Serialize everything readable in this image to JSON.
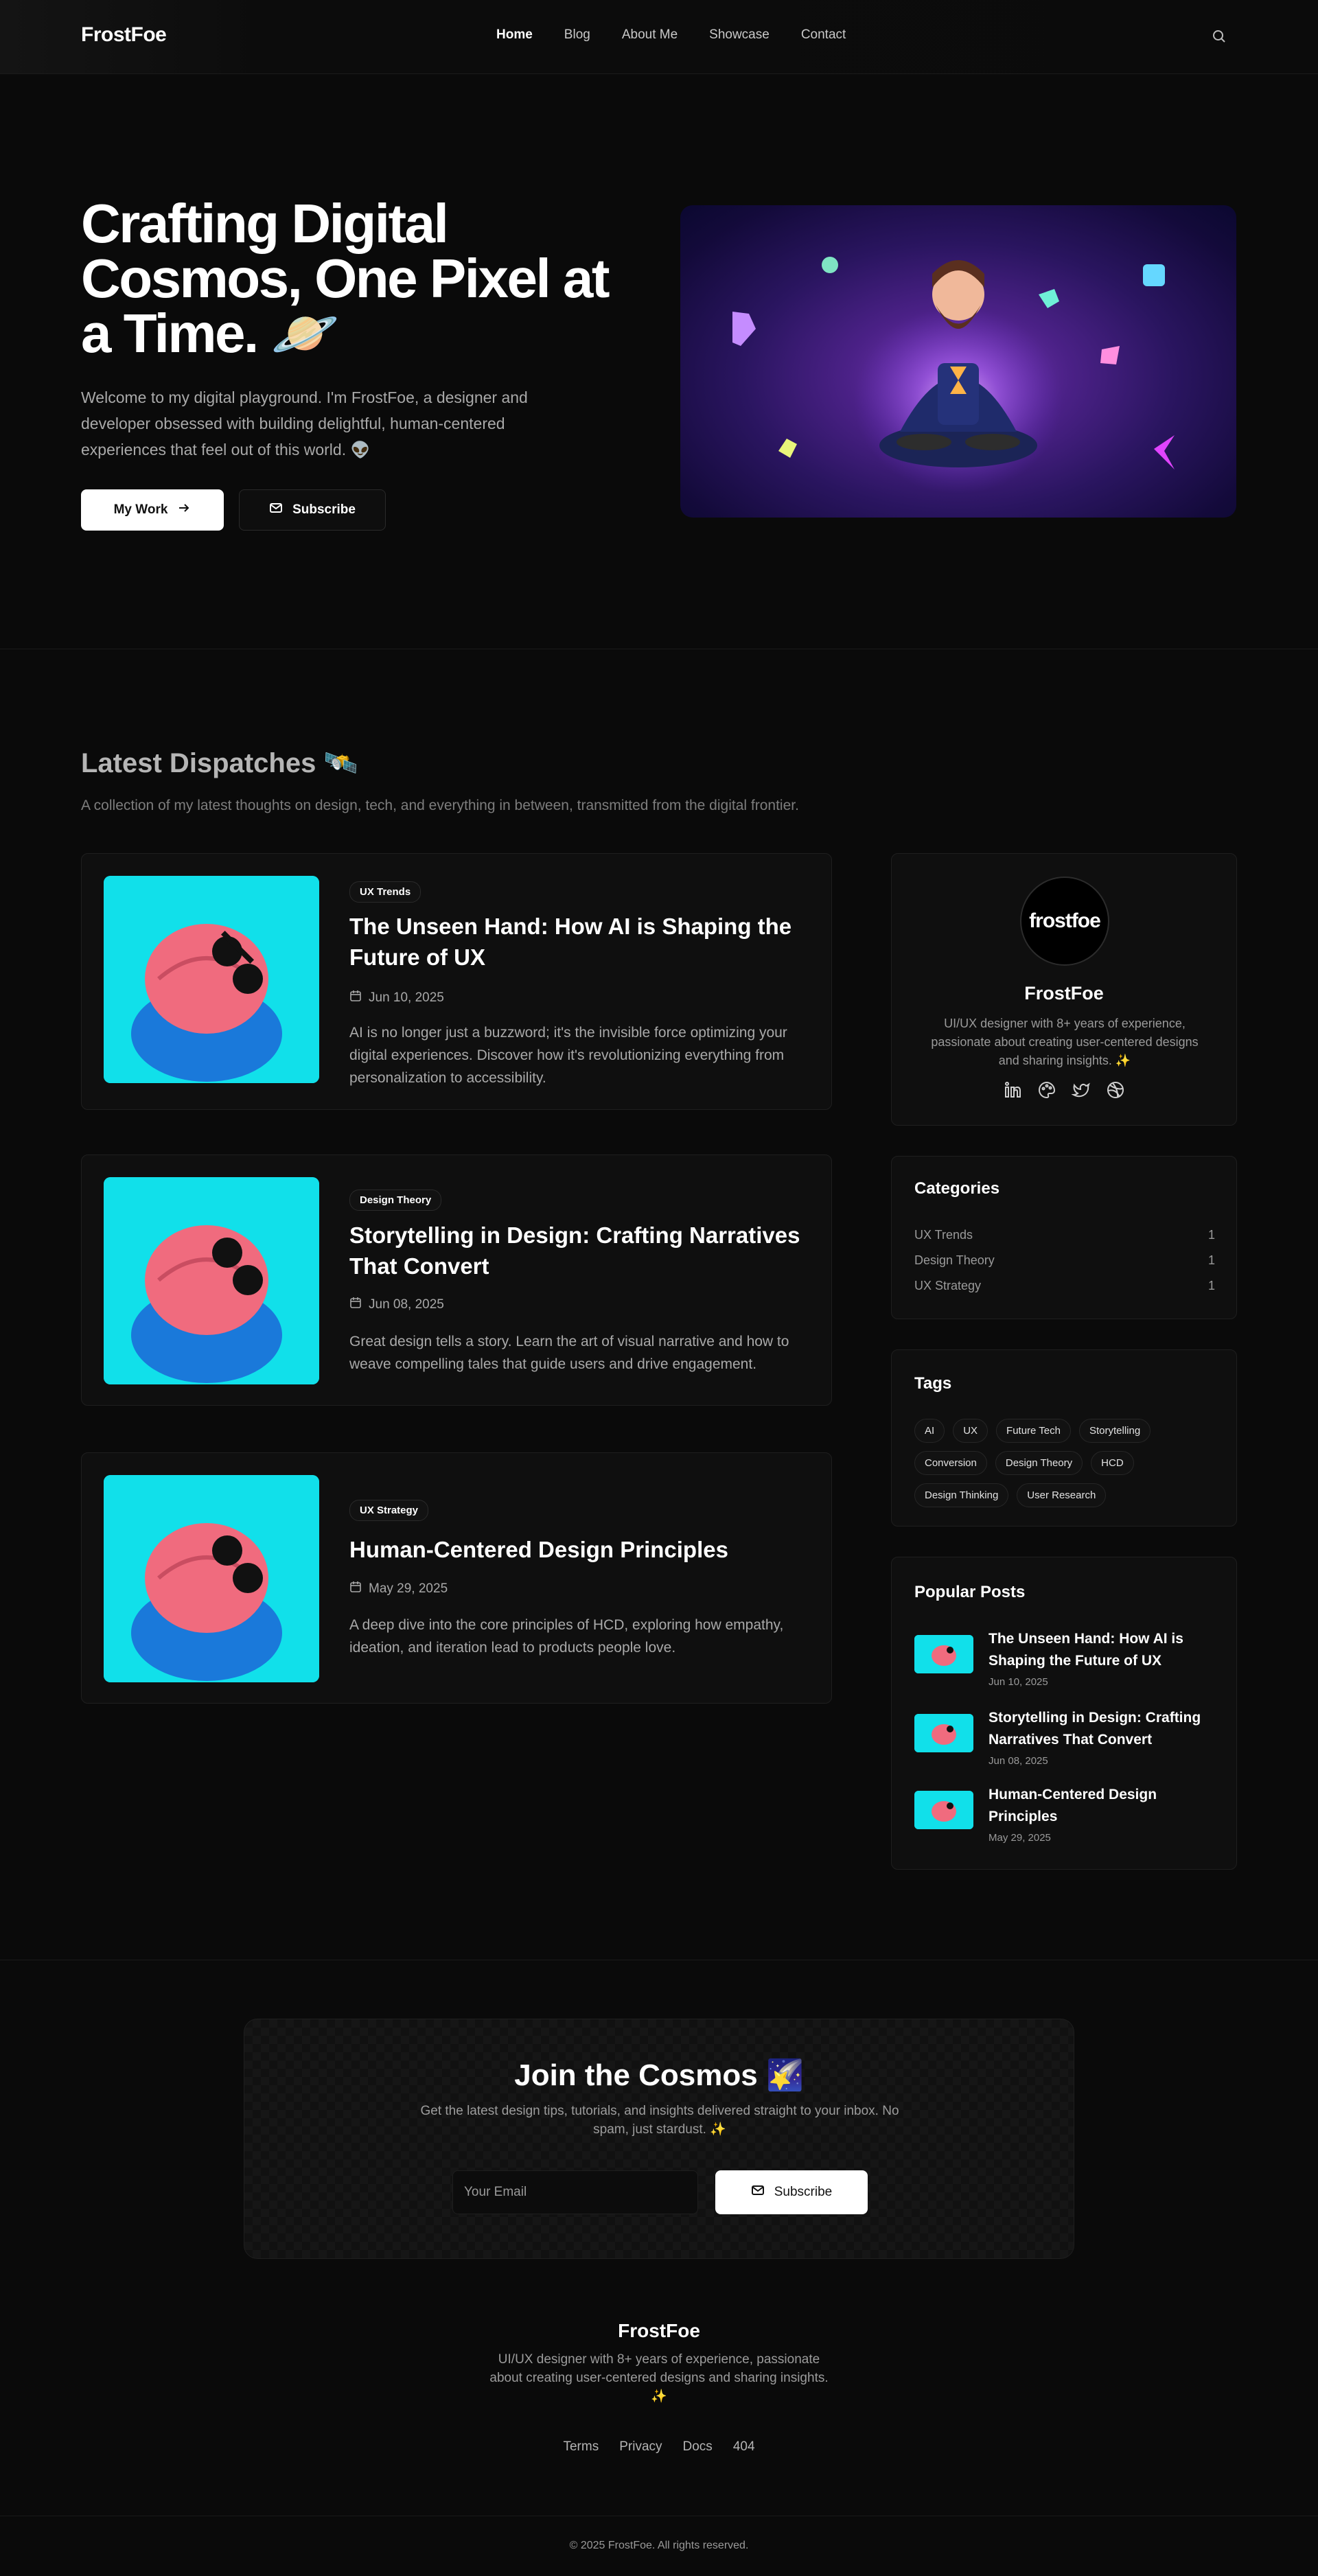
{
  "nav": {
    "logo": "FrostFoe",
    "links": [
      "Home",
      "Blog",
      "About Me",
      "Showcase",
      "Contact"
    ],
    "active": "Home"
  },
  "hero": {
    "title": "Crafting Digital Cosmos, One Pixel at a Time. 🪐",
    "description": "Welcome to my digital playground. I'm FrostFoe, a designer and developer obsessed with building delightful, human-centered experiences that feel out of this world. 👽",
    "primary_button": "My Work",
    "secondary_button": "Subscribe"
  },
  "dispatches": {
    "title": "Latest Dispatches 🛰️",
    "subtitle": "A collection of my latest thoughts on design, tech, and everything in between, transmitted from the digital frontier.",
    "posts": [
      {
        "category": "UX Trends",
        "title": "The Unseen Hand: How AI is Shaping the Future of UX",
        "date": "Jun 10, 2025",
        "excerpt": "AI is no longer just a buzzword; it's the invisible force optimizing your digital experiences. Discover how it's revolutionizing everything from personalization to accessibility."
      },
      {
        "category": "Design Theory",
        "title": "Storytelling in Design: Crafting Narratives That Convert",
        "date": "Jun 08, 2025",
        "excerpt": "Great design tells a story. Learn the art of visual narrative and how to weave compelling tales that guide users and drive engagement."
      },
      {
        "category": "UX Strategy",
        "title": "Human-Centered Design Principles",
        "date": "May 29, 2025",
        "excerpt": "A deep dive into the core principles of HCD, exploring how empathy, ideation, and iteration lead to products people love."
      }
    ]
  },
  "sidebar": {
    "profile": {
      "avatar_text": "frostfoe",
      "name": "FrostFoe",
      "bio": "UI/UX designer with 8+ years of experience, passionate about creating user-centered designs and sharing insights. ✨",
      "socials": [
        "linkedin-icon",
        "palette-icon",
        "twitter-icon",
        "dribbble-icon"
      ]
    },
    "categories": {
      "title": "Categories",
      "items": [
        {
          "name": "UX Trends",
          "count": "1"
        },
        {
          "name": "Design Theory",
          "count": "1"
        },
        {
          "name": "UX Strategy",
          "count": "1"
        }
      ]
    },
    "tags": {
      "title": "Tags",
      "items": [
        "AI",
        "UX",
        "Future Tech",
        "Storytelling",
        "Conversion",
        "Design Theory",
        "HCD",
        "Design Thinking",
        "User Research"
      ]
    },
    "popular": {
      "title": "Popular Posts",
      "items": [
        {
          "title": "The Unseen Hand: How AI is Shaping the Future of UX",
          "date": "Jun 10, 2025"
        },
        {
          "title": "Storytelling in Design: Crafting Narratives That Convert",
          "date": "Jun 08, 2025"
        },
        {
          "title": "Human-Centered Design Principles",
          "date": "May 29, 2025"
        }
      ]
    }
  },
  "newsletter": {
    "title": "Join the Cosmos 🌠",
    "description": "Get the latest design tips, tutorials, and insights delivered straight to your inbox. No spam, just stardust. ✨",
    "placeholder": "Your Email",
    "button": "Subscribe"
  },
  "footer": {
    "logo": "FrostFoe",
    "description": "UI/UX designer with 8+ years of experience, passionate about creating user-centered designs and sharing insights. ✨",
    "links": [
      "Terms",
      "Privacy",
      "Docs",
      "404"
    ],
    "copyright": "© 2025 FrostFoe. All rights reserved."
  },
  "colors": {
    "background": "#0a0a0a",
    "card": "#0f0f0f",
    "thumb_cyan": "#11e0ea",
    "accent_purple": "#4b2187"
  }
}
